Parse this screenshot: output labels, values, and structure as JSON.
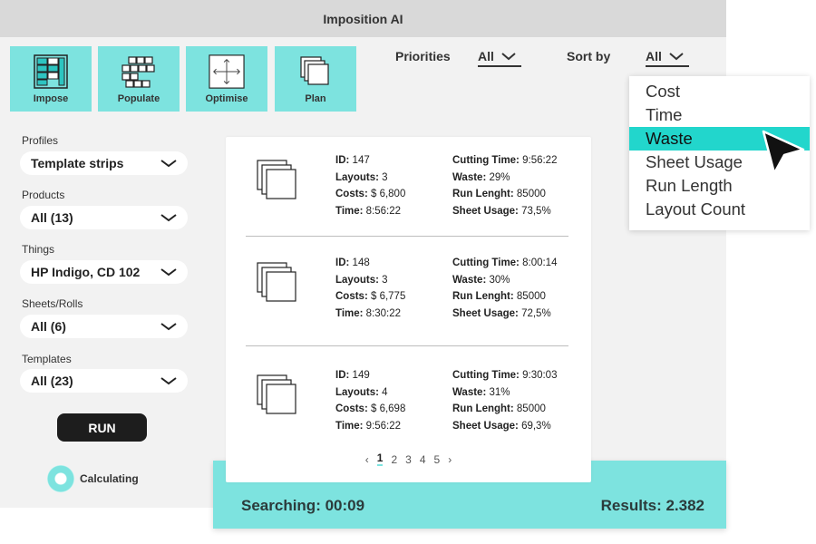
{
  "window": {
    "title": "Imposition AI"
  },
  "toolbar": [
    {
      "label": "Impose",
      "icon": "impose-icon"
    },
    {
      "label": "Populate",
      "icon": "populate-icon"
    },
    {
      "label": "Optimise",
      "icon": "optimise-icon"
    },
    {
      "label": "Plan",
      "icon": "plan-icon"
    }
  ],
  "header": {
    "priorities_label": "Priorities",
    "priorities_value": "All",
    "sort_label": "Sort by",
    "sort_value": "All"
  },
  "sort_menu": {
    "options": [
      "Cost",
      "Time",
      "Waste",
      "Sheet Usage",
      "Run Length",
      "Layout Count"
    ],
    "highlighted": "Waste"
  },
  "filters": [
    {
      "label": "Profiles",
      "value": "Template strips"
    },
    {
      "label": "Products",
      "value": "All (13)"
    },
    {
      "label": "Things",
      "value": "HP Indigo, CD 102"
    },
    {
      "label": "Sheets/Rolls",
      "value": "All (6)"
    },
    {
      "label": "Templates",
      "value": "All (23)"
    }
  ],
  "run_button": "RUN",
  "status": "Calculating",
  "results": [
    {
      "id_label": "ID:",
      "id": "147",
      "layouts_label": "Layouts:",
      "layouts": "3",
      "costs_label": "Costs:",
      "costs": "$ 6,800",
      "time_label": "Time:",
      "time": "8:56:22",
      "cutting_label": "Cutting Time:",
      "cutting": "9:56:22",
      "waste_label": "Waste:",
      "waste": "29%",
      "run_label": "Run Lenght:",
      "run": "85000",
      "usage_label": "Sheet Usage:",
      "usage": "73,5%"
    },
    {
      "id_label": "ID:",
      "id": "148",
      "layouts_label": "Layouts:",
      "layouts": "3",
      "costs_label": "Costs:",
      "costs": "$ 6,775",
      "time_label": "Time:",
      "time": "8:30:22",
      "cutting_label": "Cutting Time:",
      "cutting": "8:00:14",
      "waste_label": "Waste:",
      "waste": "30%",
      "run_label": "Run Lenght:",
      "run": "85000",
      "usage_label": "Sheet Usage:",
      "usage": "72,5%"
    },
    {
      "id_label": "ID:",
      "id": "149",
      "layouts_label": "Layouts:",
      "layouts": "4",
      "costs_label": "Costs:",
      "costs": "$ 6,698",
      "time_label": "Time:",
      "time": "9:56:22",
      "cutting_label": "Cutting Time:",
      "cutting": "9:30:03",
      "waste_label": "Waste:",
      "waste": "31%",
      "run_label": "Run Lenght:",
      "run": "85000",
      "usage_label": "Sheet Usage:",
      "usage": "69,3%"
    }
  ],
  "pagination": {
    "pages": [
      "1",
      "2",
      "3",
      "4",
      "5"
    ],
    "current": "1",
    "prev": "‹",
    "next": "›"
  },
  "footer": {
    "searching": "Searching: 00:09",
    "results": "Results: 2.382"
  },
  "colors": {
    "accent": "#7de3df",
    "highlight": "#22d6cc",
    "dark": "#1d1d1d",
    "panel": "#f2f2f2"
  }
}
